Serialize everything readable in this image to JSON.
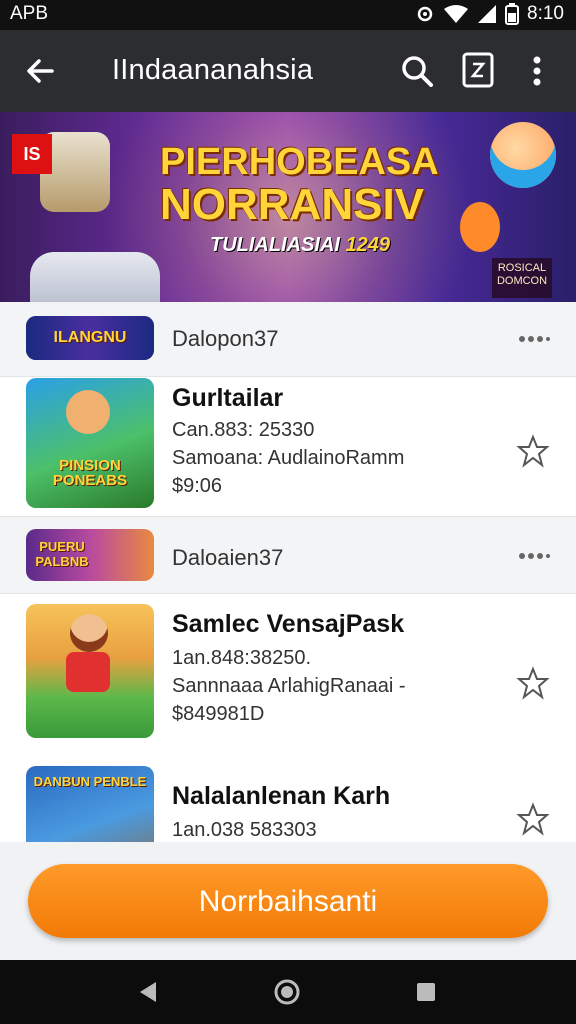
{
  "status_bar": {
    "carrier": "APB",
    "time": "8:10",
    "icons": [
      "settings-icon",
      "wifi-icon",
      "signal-icon",
      "battery-icon"
    ]
  },
  "app_bar": {
    "title": "IIndaananahsia",
    "icons": [
      "back-arrow-icon",
      "search-icon",
      "badge-icon",
      "more-vert-icon"
    ]
  },
  "banner": {
    "line1": "PIERHOBEASA",
    "line2": "NORRANSIV",
    "subtitle": "TULIALIASIAI",
    "date": "1249",
    "red_tag": "IS",
    "corner_text": "ROSICAL DOMCON"
  },
  "list": {
    "items": [
      {
        "type": "compact",
        "thumb_label": "ILANGNU",
        "name": "Dalopon37"
      },
      {
        "type": "full",
        "thumb_label": "PINSION PONEABS",
        "name": "Gurltailar",
        "line1": "Can.883: 25330",
        "line2": "Samoana: AudlainoRamm",
        "line3": "$9:06"
      },
      {
        "type": "compact",
        "thumb_label": "PUERU PALBNB",
        "name": "Daloaien37"
      },
      {
        "type": "full",
        "thumb_label": "",
        "name": "Samlec VensajPask",
        "line1": "1an.848:38250.",
        "line2": "Sannnaaa ArlahigRanaai -",
        "line3": "$849981D"
      },
      {
        "type": "full",
        "thumb_label": "DANBUN PENBLE",
        "name": "Nalalanlenan Karh",
        "line1": "1an.038 583303",
        "line2": "",
        "line3": ""
      }
    ]
  },
  "cta": {
    "label": "Norrbaihsanti"
  },
  "nav_bar": {
    "icons": [
      "nav-back-icon",
      "nav-home-icon",
      "nav-recents-icon"
    ]
  },
  "colors": {
    "app_bar": "#2b2d31",
    "cta": "#f27a05",
    "banner_title": "#ffd53a"
  }
}
